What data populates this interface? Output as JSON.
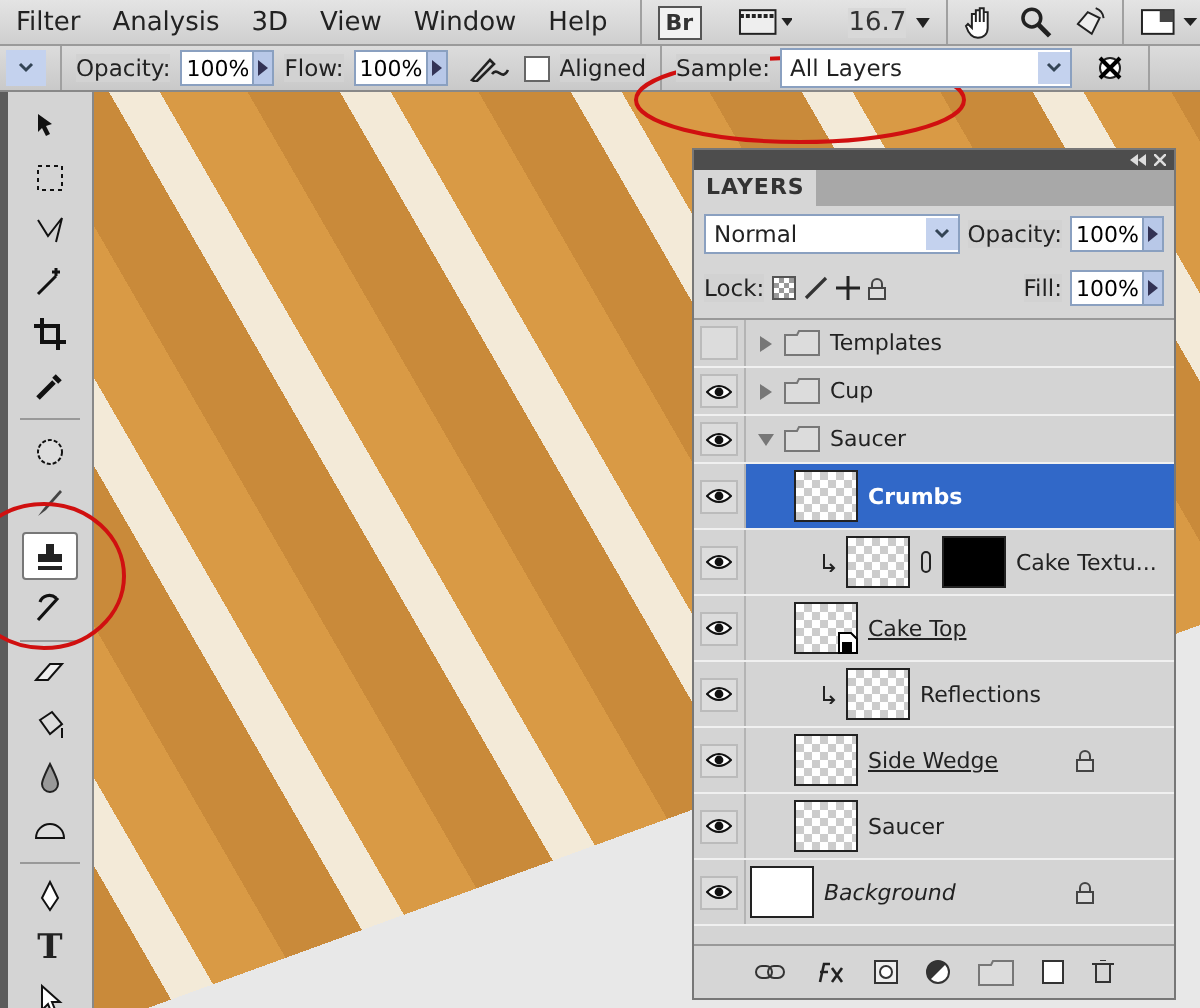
{
  "menu": [
    "Filter",
    "Analysis",
    "3D",
    "View",
    "Window",
    "Help"
  ],
  "app_bar": {
    "bridge": "Br",
    "zoom": "16.7"
  },
  "options_bar": {
    "opacity_label": "Opacity:",
    "opacity": "100%",
    "flow_label": "Flow:",
    "flow": "100%",
    "aligned": {
      "label": "Aligned",
      "checked": false
    },
    "sample_label": "Sample:",
    "sample": "All Layers"
  },
  "tools": [
    {
      "kind": "move",
      "selected": false
    },
    {
      "kind": "marquee",
      "selected": false
    },
    {
      "kind": "lasso",
      "selected": false
    },
    {
      "kind": "wand",
      "selected": false
    },
    {
      "kind": "crop",
      "selected": false
    },
    {
      "kind": "eyedropper",
      "selected": false
    },
    {
      "kind": "sep"
    },
    {
      "kind": "healing",
      "selected": false
    },
    {
      "kind": "brush",
      "selected": false
    },
    {
      "kind": "stamp",
      "selected": true
    },
    {
      "kind": "history",
      "selected": false
    },
    {
      "kind": "sep"
    },
    {
      "kind": "eraser",
      "selected": false
    },
    {
      "kind": "bucket",
      "selected": false
    },
    {
      "kind": "blur",
      "selected": false
    },
    {
      "kind": "dodge",
      "selected": false
    },
    {
      "kind": "sep"
    },
    {
      "kind": "pen",
      "selected": false
    },
    {
      "kind": "type",
      "label": "T",
      "selected": false
    },
    {
      "kind": "path",
      "selected": false
    }
  ],
  "layers_panel": {
    "title": "LAYERS",
    "blend_mode": "Normal",
    "opacity_label": "Opacity:",
    "opacity": "100%",
    "lock_label": "Lock:",
    "fill_label": "Fill:",
    "fill": "100%",
    "layers": [
      {
        "kind": "group",
        "name": "Templates",
        "visible": false,
        "expanded": false,
        "selected": false
      },
      {
        "kind": "group",
        "name": "Cup",
        "visible": true,
        "expanded": false,
        "selected": false
      },
      {
        "kind": "group",
        "name": "Saucer",
        "visible": true,
        "expanded": true,
        "selected": false,
        "children": [
          {
            "kind": "layer",
            "name": "Crumbs",
            "visible": true,
            "selected": true,
            "clipped": false,
            "mask": false,
            "underlined": false,
            "locked": false
          },
          {
            "kind": "layer",
            "name": "Cake Textu...",
            "visible": true,
            "selected": false,
            "clipped": true,
            "mask": true,
            "underlined": false,
            "locked": false
          },
          {
            "kind": "smart",
            "name": "Cake Top",
            "visible": true,
            "selected": false,
            "clipped": false,
            "mask": false,
            "underlined": true,
            "locked": false
          },
          {
            "kind": "layer",
            "name": "Reflections",
            "visible": true,
            "selected": false,
            "clipped": true,
            "mask": false,
            "underlined": false,
            "locked": false
          },
          {
            "kind": "layer",
            "name": "Side Wedge",
            "visible": true,
            "selected": false,
            "clipped": false,
            "mask": false,
            "underlined": true,
            "locked": true
          },
          {
            "kind": "layer",
            "name": "Saucer",
            "visible": true,
            "selected": false,
            "clipped": false,
            "mask": false,
            "underlined": false,
            "locked": false
          }
        ]
      },
      {
        "kind": "background",
        "name": "Background",
        "visible": true,
        "selected": false,
        "clipped": false,
        "mask": false,
        "underlined": false,
        "locked": true
      }
    ]
  }
}
